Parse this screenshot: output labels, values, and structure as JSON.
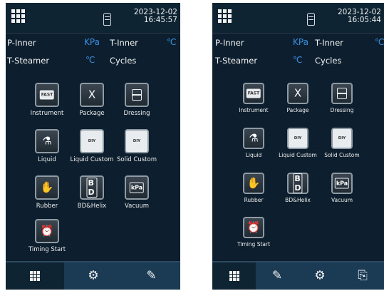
{
  "screens": [
    {
      "datetime_date": "2023-12-02",
      "datetime_time": "16:45:57",
      "readings": {
        "p_inner_label": "P-Inner",
        "p_inner_unit": "KPa",
        "t_inner_label": "T-Inner",
        "t_inner_unit": "℃",
        "t_steamer_label": "T-Steamer",
        "t_steamer_unit": "℃",
        "cycles_label": "Cycles"
      },
      "tiles": [
        {
          "label": "Instrument",
          "icon": "fast-icon",
          "glyph": "FAST"
        },
        {
          "label": "Package",
          "icon": "scissors-icon",
          "glyph": "Ⅹ"
        },
        {
          "label": "Dressing",
          "icon": "dressing-icon",
          "glyph": ""
        },
        {
          "label": "Liquid",
          "icon": "flask-icon",
          "glyph": "⚗"
        },
        {
          "label": "Liquid Custom",
          "icon": "flask-diy-icon",
          "glyph": "DIY"
        },
        {
          "label": "Solid Custom",
          "icon": "cube-diy-icon",
          "glyph": "DIY"
        },
        {
          "label": "Rubber",
          "icon": "glove-icon",
          "glyph": "✋"
        },
        {
          "label": "BD&Helix",
          "icon": "bd-icon",
          "glyph": "B D"
        },
        {
          "label": "Vacuum",
          "icon": "vacuum-icon",
          "glyph": "kPa"
        },
        {
          "label": "Timing Start",
          "icon": "alarm-clock-icon",
          "glyph": "⏰"
        }
      ],
      "tabs": [
        {
          "icon": "grid-menu-icon"
        },
        {
          "icon": "settings-gear-icon"
        },
        {
          "icon": "edit-log-icon"
        }
      ]
    },
    {
      "datetime_date": "2023-12-02",
      "datetime_time": "16:05:44",
      "readings": {
        "p_inner_label": "P-Inner",
        "p_inner_unit": "KPa",
        "t_inner_label": "T-Inner",
        "t_inner_unit": "℃",
        "t_steamer_label": "T-Steamer",
        "t_steamer_unit": "℃",
        "cycles_label": "Cycles"
      },
      "tiles": [
        {
          "label": "Instrument",
          "icon": "fast-icon",
          "glyph": "FAST"
        },
        {
          "label": "Package",
          "icon": "scissors-icon",
          "glyph": "Ⅹ"
        },
        {
          "label": "Dressing",
          "icon": "dressing-icon",
          "glyph": ""
        },
        {
          "label": "Liquid",
          "icon": "flask-icon",
          "glyph": "⚗"
        },
        {
          "label": "Liquid Custom",
          "icon": "flask-diy-icon",
          "glyph": "DIY"
        },
        {
          "label": "Solid Custom",
          "icon": "cube-diy-icon",
          "glyph": "DIY"
        },
        {
          "label": "Rubber",
          "icon": "glove-icon",
          "glyph": "✋"
        },
        {
          "label": "BD&Helix",
          "icon": "bd-icon",
          "glyph": "B D"
        },
        {
          "label": "Vacuum",
          "icon": "vacuum-icon",
          "glyph": "kPa"
        },
        {
          "label": "Timing Start",
          "icon": "alarm-clock-icon",
          "glyph": "⏰"
        }
      ],
      "tabs": [
        {
          "icon": "grid-menu-icon"
        },
        {
          "icon": "edit-log-icon"
        },
        {
          "icon": "settings-gear-icon"
        },
        {
          "icon": "exit-door-icon"
        }
      ]
    }
  ],
  "theme": {
    "panel_bg": "#0d1f2e",
    "unit_blue": "#3a8ee0",
    "tab_bg": "#1b3b55"
  }
}
